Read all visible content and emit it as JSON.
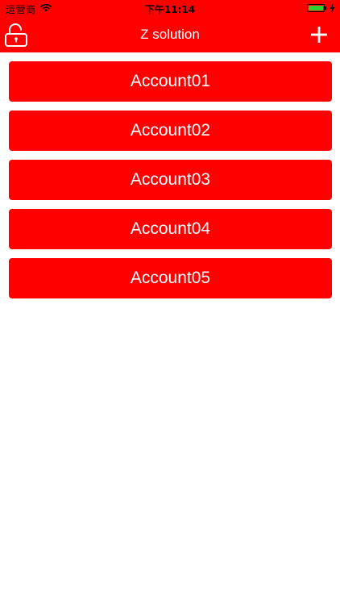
{
  "status_bar": {
    "carrier": "运营商",
    "time": "下午11:14",
    "wifi_icon": "wifi-icon",
    "battery_icon": "battery-icon",
    "battery_level": 1.0,
    "charging_icon": "bolt-icon",
    "battery_color": "#2fd12f"
  },
  "nav": {
    "title": "Z solution",
    "left_icon": "unlock-icon",
    "right_icon": "plus-icon",
    "background": "#fe0000"
  },
  "accounts": [
    {
      "label": "Account01"
    },
    {
      "label": "Account02"
    },
    {
      "label": "Account03"
    },
    {
      "label": "Account04"
    },
    {
      "label": "Account05"
    }
  ]
}
